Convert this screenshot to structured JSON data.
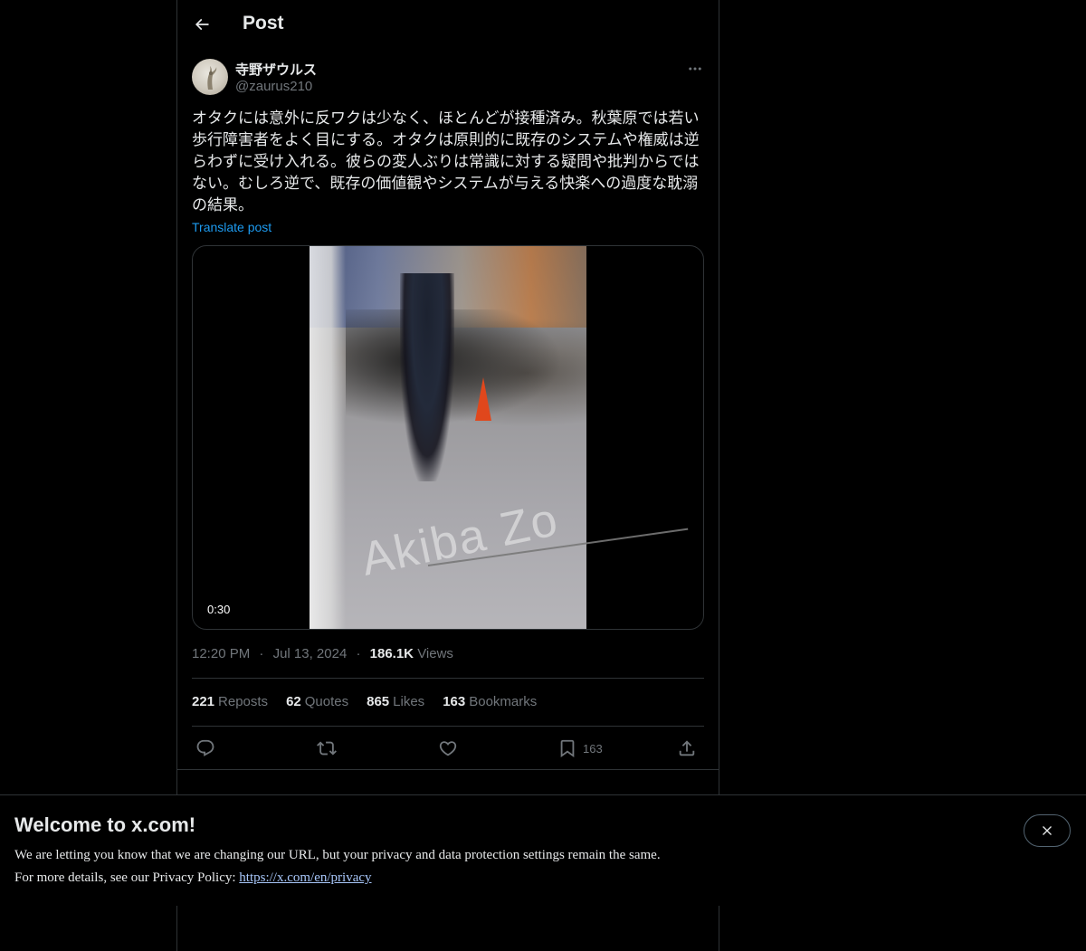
{
  "header": {
    "title": "Post",
    "back_icon": "arrow-left-icon"
  },
  "post": {
    "author_name": "寺野ザウルス",
    "author_handle": "@zaurus210",
    "text": "オタクには意外に反ワクは少なく、ほとんどが接種済み。秋葉原では若い歩行障害者をよく目にする。オタクは原則的に既存のシステムや権威は逆らわずに受け入れる。彼らの変人ぶりは常識に対する疑問や批判からではない。むしろ逆で、既存の価値観やシステムが与える快楽への過度な耽溺の結果。",
    "translate_label": "Translate post",
    "video_duration": "0:30",
    "video_watermark": "Akiba Zo",
    "time": "12:20 PM",
    "date": "Jul 13, 2024",
    "views_count": "186.1K",
    "views_label": "Views",
    "separator": "·"
  },
  "stats": {
    "reposts_count": "221",
    "reposts_label": "Reposts",
    "quotes_count": "62",
    "quotes_label": "Quotes",
    "likes_count": "865",
    "likes_label": "Likes",
    "bookmarks_count": "163",
    "bookmarks_label": "Bookmarks"
  },
  "actions": {
    "reply_icon": "reply-icon",
    "repost_icon": "repost-icon",
    "like_icon": "heart-icon",
    "bookmark_icon": "bookmark-icon",
    "bookmark_count": "163",
    "share_icon": "share-icon"
  },
  "banner": {
    "title": "Welcome to x.com!",
    "line1": "We are letting you know that we are changing our URL, but your privacy and data protection settings remain the same.",
    "line2_prefix": "For more details, see our Privacy Policy: ",
    "link_text": "https://x.com/en/privacy"
  },
  "colors": {
    "background": "#000000",
    "text_primary": "#e7e9ea",
    "text_secondary": "#71767b",
    "accent": "#1d9bf0",
    "border": "#2f3336"
  }
}
